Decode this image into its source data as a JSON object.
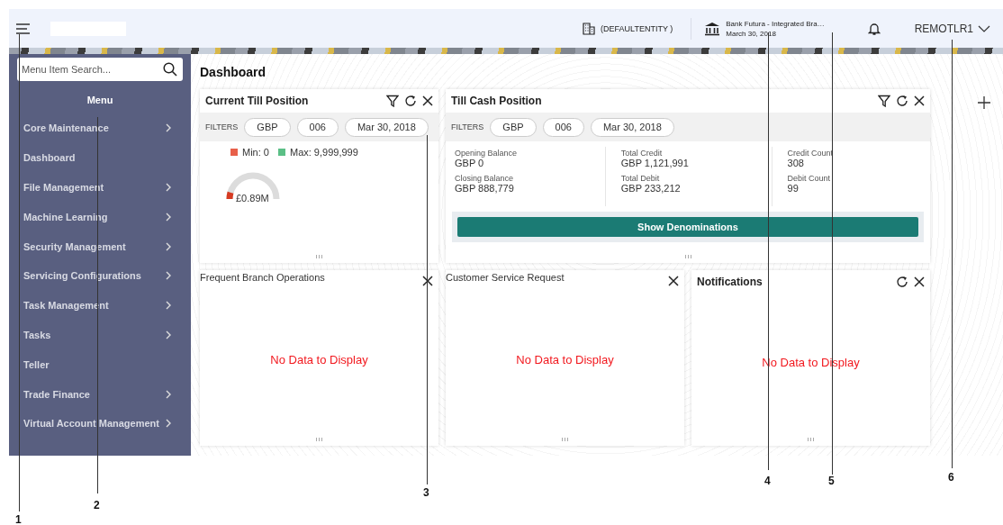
{
  "header": {
    "entity": "(DEFAULTENTITY )",
    "branch": "Bank Futura - Integrated Bra…",
    "date": "March 30, 2018",
    "user": "REMOTLR1"
  },
  "sidebar": {
    "search": {
      "placeholder": "Menu Item Search..."
    },
    "title": "Menu",
    "items": [
      {
        "label": "Core Maintenance",
        "has_submenu": true
      },
      {
        "label": "Dashboard",
        "has_submenu": false
      },
      {
        "label": "File Management",
        "has_submenu": true
      },
      {
        "label": "Machine Learning",
        "has_submenu": true
      },
      {
        "label": "Security Management",
        "has_submenu": true
      },
      {
        "label": "Servicing Configurations",
        "has_submenu": true
      },
      {
        "label": "Task Management",
        "has_submenu": true
      },
      {
        "label": "Tasks",
        "has_submenu": true
      },
      {
        "label": "Teller",
        "has_submenu": false
      },
      {
        "label": "Trade Finance",
        "has_submenu": true
      },
      {
        "label": "Virtual Account Management",
        "has_submenu": true
      }
    ]
  },
  "page_title": "Dashboard",
  "cards": [
    {
      "kind": "till",
      "title": "Current Till Position",
      "filterable": true,
      "refreshable": true,
      "closable": true,
      "filters_label": "FILTERS",
      "filters": [
        "GBP",
        "006",
        "Mar 30, 2018"
      ],
      "legend": [
        {
          "label": "Min: 0",
          "color": "#e8604a"
        },
        {
          "label": "Max: 9,999,999",
          "color": "#5bbf86"
        }
      ],
      "gauge": {
        "level": 0.09,
        "reading": "£0.89M"
      }
    },
    {
      "kind": "cash",
      "title": "Till Cash Position",
      "filterable": true,
      "refreshable": true,
      "closable": true,
      "filters_label": "FILTERS",
      "filters": [
        "GBP",
        "006",
        "Mar 30, 2018"
      ],
      "stats": [
        [
          {
            "label": "Opening Balance",
            "value": "GBP 0"
          },
          {
            "label": "Closing Balance",
            "value": "GBP 888,779"
          }
        ],
        [
          {
            "label": "Total Credit",
            "value": "GBP 1,121,991"
          },
          {
            "label": "Total Debit",
            "value": "GBP 233,212"
          }
        ],
        [
          {
            "label": "Credit Count",
            "value": "308"
          },
          {
            "label": "Debit Count",
            "value": "99"
          }
        ]
      ],
      "button": "Show Denominations"
    },
    {
      "kind": "panel",
      "title": "Frequent Branch Operations",
      "closable": true,
      "message": "No Data to Display"
    },
    {
      "kind": "panel",
      "title": "Customer Service Request",
      "closable": true,
      "message": "No Data to Display"
    },
    {
      "kind": "notifications",
      "title": "Notifications",
      "refreshable": true,
      "closable": true,
      "message": "No Data to Display"
    }
  ],
  "callouts": [
    "1",
    "2",
    "3",
    "4",
    "5",
    "6"
  ]
}
